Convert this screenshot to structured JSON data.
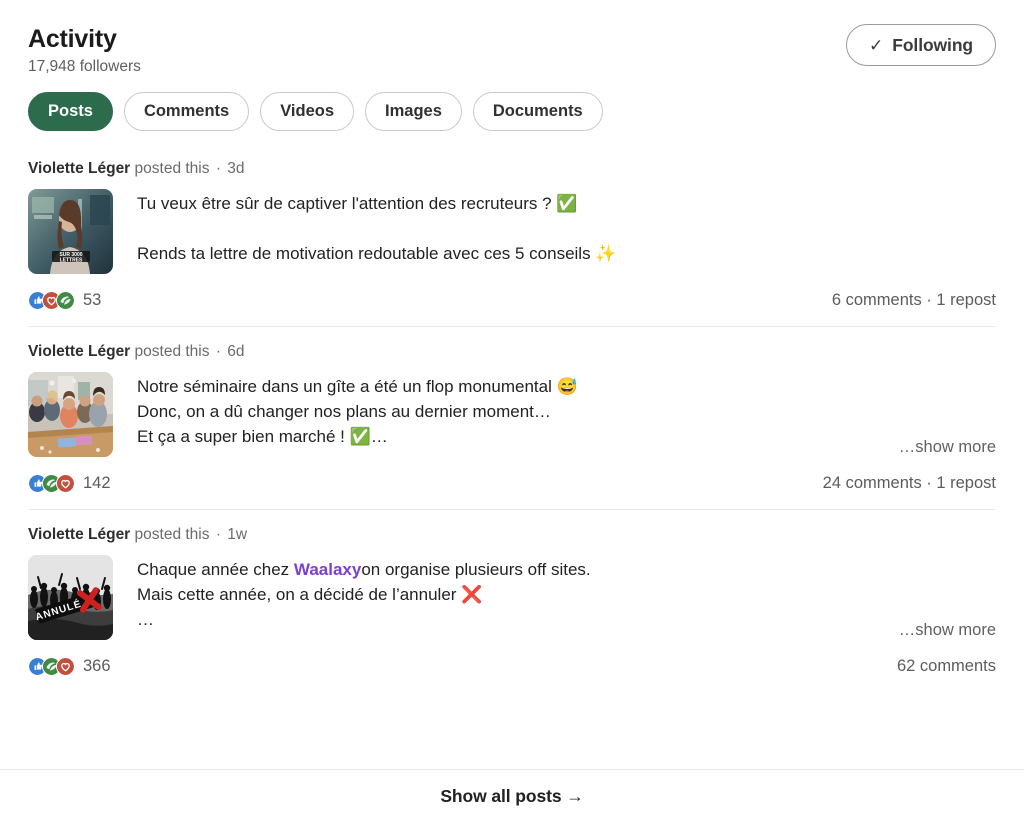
{
  "header": {
    "title": "Activity",
    "followers": "17,948 followers",
    "follow_button": {
      "label": "Following",
      "check_glyph": "✓"
    }
  },
  "filters": {
    "active": "Posts",
    "items": [
      {
        "label": "Posts",
        "active": true
      },
      {
        "label": "Comments",
        "active": false
      },
      {
        "label": "Videos",
        "active": false
      },
      {
        "label": "Images",
        "active": false
      },
      {
        "label": "Documents",
        "active": false
      }
    ]
  },
  "posts": [
    {
      "author": "Violette Léger",
      "action": "posted this",
      "separator": "·",
      "age": "3d",
      "thumbnail": {
        "name": "post-thumbnail-video-lettres",
        "overlay_line1": "SUR 3000",
        "overlay_line2": "LETTRES"
      },
      "lines": [
        "Tu veux être sûr de captiver l'attention des recruteurs ? ✅",
        "",
        "Rends ta lettre de motivation redoutable avec ces 5 conseils ✨"
      ],
      "show_more": "",
      "reactions": {
        "types": [
          "like-icon",
          "love-icon",
          "support-icon"
        ],
        "count": "53"
      },
      "counts": "6 comments · 1 repost"
    },
    {
      "author": "Violette Léger",
      "action": "posted this",
      "separator": "·",
      "age": "6d",
      "thumbnail": {
        "name": "post-thumbnail-seminar-table",
        "overlay_line1": "",
        "overlay_line2": ""
      },
      "lines": [
        "Notre séminaire dans un gîte a été un flop monumental 😅",
        "Donc, on a dû changer nos plans au dernier moment…",
        "Et ça a super bien marché ! ✅…"
      ],
      "show_more": "…show more",
      "reactions": {
        "types": [
          "like-icon",
          "support-icon",
          "love-icon"
        ],
        "count": "142"
      },
      "counts": "24 comments · 1 repost"
    },
    {
      "author": "Violette Léger",
      "action": "posted this",
      "separator": "·",
      "age": "1w",
      "thumbnail": {
        "name": "post-thumbnail-annule-crowd",
        "overlay_line1": "ANNULÉ",
        "overlay_line2": ""
      },
      "lines": [
        "Chaque année chez |Waalaxy|on organise plusieurs off sites.",
        "Mais cette année, on a décidé de l’annuler ❌",
        "…"
      ],
      "mention": "Waalaxy",
      "show_more": "…show more",
      "reactions": {
        "types": [
          "like-icon",
          "support-icon",
          "love-icon"
        ],
        "count": "366"
      },
      "counts": "62 comments"
    }
  ],
  "footer": {
    "show_all_label": "Show all posts →"
  },
  "colors": {
    "accent_green": "#2d6b4d",
    "mention_purple": "#7a3fd4",
    "reaction_like_blue": "#3b7fd4",
    "reaction_love_red": "#c2503c",
    "reaction_support_green": "#3f8a45",
    "text_primary": "#222222",
    "text_muted": "#5c5c5c",
    "divider": "#ebebeb"
  }
}
